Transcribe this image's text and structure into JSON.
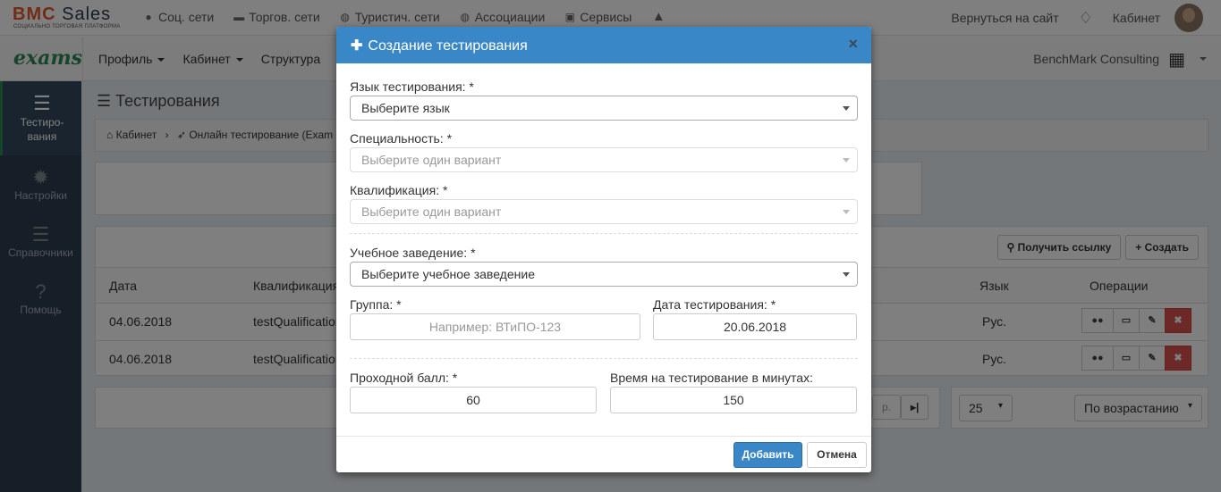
{
  "topbar": {
    "logo_main": "BMC",
    "logo_sales": "Sales",
    "logo_sub": "СОЦИАЛЬНО ТОРГОВАЯ ПЛАТФОРМА",
    "nav": [
      "Соц. сети",
      "Торгов. сети",
      "Туристич. сети",
      "Ассоциации",
      "Сервисы"
    ],
    "back_link": "Вернуться на сайт",
    "cabinet": "Кабинет"
  },
  "navbar": {
    "brand": "exams",
    "items": [
      "Профиль",
      "Кабинет",
      "Структура"
    ],
    "company": "BenchMark Consulting"
  },
  "sidebar": {
    "items": [
      {
        "label": "Тестиро-\nвания",
        "icon": "menu-icon"
      },
      {
        "label": "Настройки",
        "icon": "gear-icon"
      },
      {
        "label": "Справочники",
        "icon": "list-icon"
      },
      {
        "label": "Помощь",
        "icon": "help-icon"
      }
    ]
  },
  "main": {
    "title": "Тестирования",
    "breadcrumb": [
      "Кабинет",
      "Онлайн тестирование (Exam"
    ],
    "buttons": {
      "get_link": "Получить ссылку",
      "create": "Создать"
    },
    "columns": [
      "Дата",
      "Квалификация",
      "Язык",
      "Операции"
    ],
    "rows": [
      {
        "date": "04.06.2018",
        "qualification": "testQualification",
        "lang": "Рус."
      },
      {
        "date": "04.06.2018",
        "qualification": "testQualification",
        "lang": "Рус."
      }
    ],
    "pager_next": "р.",
    "page_size": "25",
    "sort": "По возрастанию"
  },
  "modal": {
    "title": "Создание тестирования",
    "language_label": "Язык тестирования: *",
    "language_value": "Выберите язык",
    "specialty_label": "Специальность: *",
    "specialty_value": "Выберите один вариант",
    "qualification_label": "Квалификация: *",
    "qualification_value": "Выберите один вариант",
    "institution_label": "Учебное заведение: *",
    "institution_value": "Выберите учебное заведение",
    "group_label": "Группа: *",
    "group_placeholder": "Например: ВТиПО-123",
    "date_label": "Дата тестирования: *",
    "date_value": "20.06.2018",
    "pass_label": "Проходной балл: *",
    "pass_value": "60",
    "time_label": "Время на тестирование в минутах:",
    "time_value": "150",
    "add_button": "Добавить",
    "cancel_button": "Отмена",
    "close_symbol": "×"
  }
}
